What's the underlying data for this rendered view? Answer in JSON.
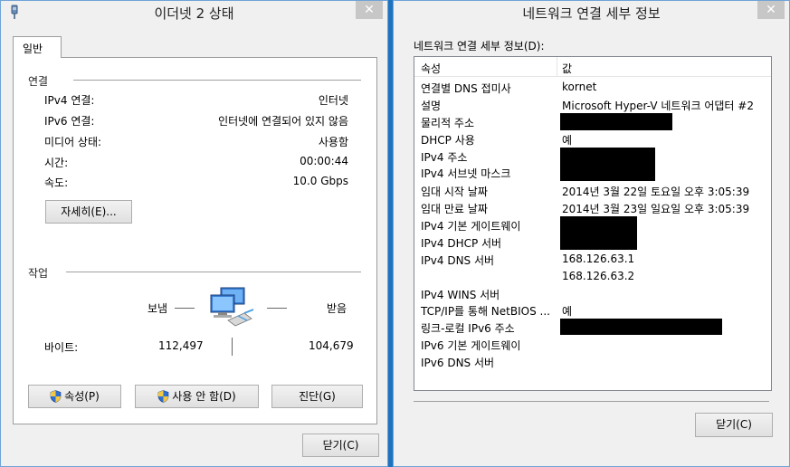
{
  "left_window": {
    "title": "이더넷 2 상태",
    "close": "✕",
    "tab": "일반",
    "connection": {
      "title": "연결",
      "rows": [
        {
          "label": "IPv4 연결:",
          "value": "인터넷"
        },
        {
          "label": "IPv6 연결:",
          "value": "인터넷에 연결되어 있지 않음"
        },
        {
          "label": "미디어 상태:",
          "value": "사용함"
        },
        {
          "label": "시간:",
          "value": "00:00:44"
        },
        {
          "label": "속도:",
          "value": "10.0 Gbps"
        }
      ],
      "details_button": "자세히(E)..."
    },
    "activity": {
      "title": "작업",
      "sent_label": "보냄",
      "received_label": "받음",
      "bytes_label": "바이트:",
      "bytes_sent": "112,497",
      "bytes_received": "104,679"
    },
    "buttons": {
      "properties": "속성(P)",
      "disable": "사용 안 함(D)",
      "diagnose": "진단(G)",
      "close": "닫기(C)"
    }
  },
  "right_window": {
    "title": "네트워크 연결 세부 정보",
    "close": "✕",
    "details_label": "네트워크 연결 세부 정보(D):",
    "columns": [
      "속성",
      "값"
    ],
    "rows": [
      {
        "prop": "연결별 DNS 접미사",
        "val": "kornet"
      },
      {
        "prop": "설명",
        "val": "Microsoft Hyper-V 네트워크 어댑터 #2"
      },
      {
        "prop": "물리적 주소",
        "val": ""
      },
      {
        "prop": "DHCP 사용",
        "val": "예"
      },
      {
        "prop": "IPv4 주소",
        "val": ""
      },
      {
        "prop": "IPv4 서브넷 마스크",
        "val": ""
      },
      {
        "prop": "임대 시작 날짜",
        "val": "2014년 3월 22일 토요일 오후 3:05:39"
      },
      {
        "prop": "임대 만료 날짜",
        "val": "2014년 3월 23일 일요일 오후 3:05:39"
      },
      {
        "prop": "IPv4 기본 게이트웨이",
        "val": ""
      },
      {
        "prop": "IPv4 DHCP 서버",
        "val": ""
      },
      {
        "prop": "IPv4 DNS 서버",
        "val": "168.126.63.1"
      },
      {
        "prop": "",
        "val": "168.126.63.2"
      },
      {
        "prop": "IPv4 WINS 서버",
        "val": ""
      },
      {
        "prop": "TCP/IP를 통해 NetBIOS ...",
        "val": "예"
      },
      {
        "prop": "링크-로컬 IPv6 주소",
        "val": ""
      },
      {
        "prop": "IPv6 기본 게이트웨이",
        "val": ""
      },
      {
        "prop": "IPv6 DNS 서버",
        "val": ""
      }
    ],
    "close_button": "닫기(C)"
  },
  "colors": {
    "desktop": "#1e73be",
    "window_bg": "#f0f0f0",
    "close_button": "#c7c7c7",
    "redaction": "#000000"
  },
  "icons": [
    "network-adapter-app-icon",
    "close-icon",
    "uac-shield-icon",
    "network-computers-icon"
  ]
}
